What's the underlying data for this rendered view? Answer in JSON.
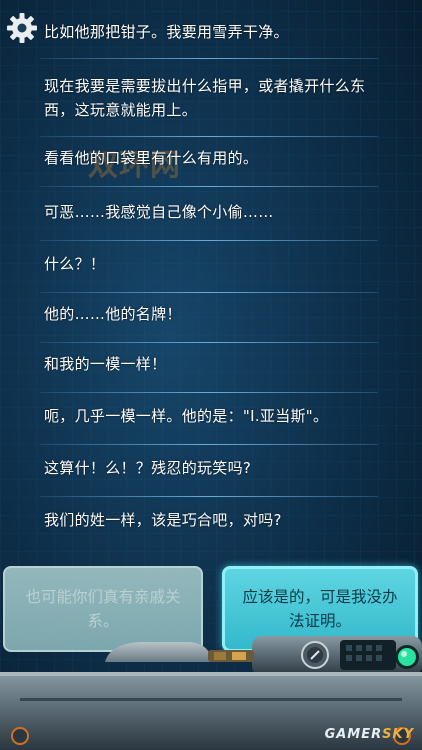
{
  "settings": {
    "icon": "gear-icon"
  },
  "dialogue": [
    "比如他那把钳子。我要用雪弄干净。",
    "现在我要是需要拔出什么指甲，或者撬开什么东西，这玩意就能用上。",
    "看看他的口袋里有什么有用的。",
    "可恶……我感觉自己像个小偷……",
    "什么？！",
    "他的……他的名牌！",
    "和我的一模一样！",
    "呃，几乎一模一样。他的是：\"I.亚当斯\"。",
    "这算什！么！？残忍的玩笑吗?",
    "我们的姓一样，该是巧合吧，对吗?"
  ],
  "watermark": "双环网",
  "choices": {
    "left": "也可能你们真有亲戚关系。",
    "right": "应该是的，可是我没办法证明。"
  },
  "brand": {
    "part1": "GAMER",
    "part2": "SKY"
  },
  "colors": {
    "background": "#0d2d47",
    "separator": "#78bef0",
    "choice_active": "#46c8d8",
    "choice_inactive": "#92babd",
    "status_light": "#27e2a0"
  }
}
